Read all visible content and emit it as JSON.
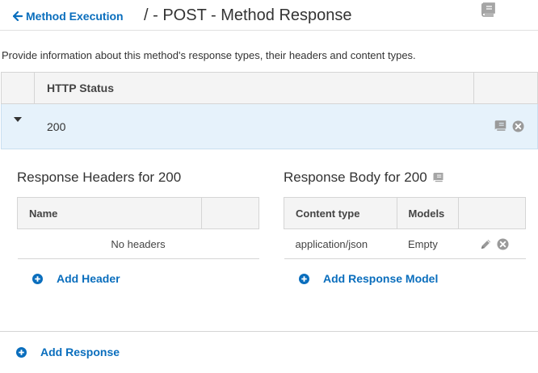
{
  "header": {
    "back_label": "Method Execution",
    "title": "/ - POST - Method Response"
  },
  "description": "Provide information about this method's response types, their headers and content types.",
  "status_table": {
    "column_header": "HTTP Status",
    "rows": [
      {
        "status": "200"
      }
    ]
  },
  "response_headers": {
    "title": "Response Headers for 200",
    "columns": [
      "Name"
    ],
    "empty_text": "No headers",
    "add_label": "Add Header"
  },
  "response_body": {
    "title": "Response Body for 200",
    "columns": [
      "Content type",
      "Models"
    ],
    "rows": [
      {
        "content_type": "application/json",
        "model": "Empty"
      }
    ],
    "add_label": "Add Response Model"
  },
  "add_response_label": "Add Response",
  "colors": {
    "link": "#0a6ebd",
    "selected_row": "#e6f2fb",
    "icon_grey": "#9a9a9a"
  },
  "icons": {
    "back": "arrow-left-icon",
    "docs": "book-icon",
    "remove": "remove-circle-icon",
    "edit": "pencil-icon",
    "add": "plus-circle-icon",
    "expand": "caret-down-icon"
  }
}
